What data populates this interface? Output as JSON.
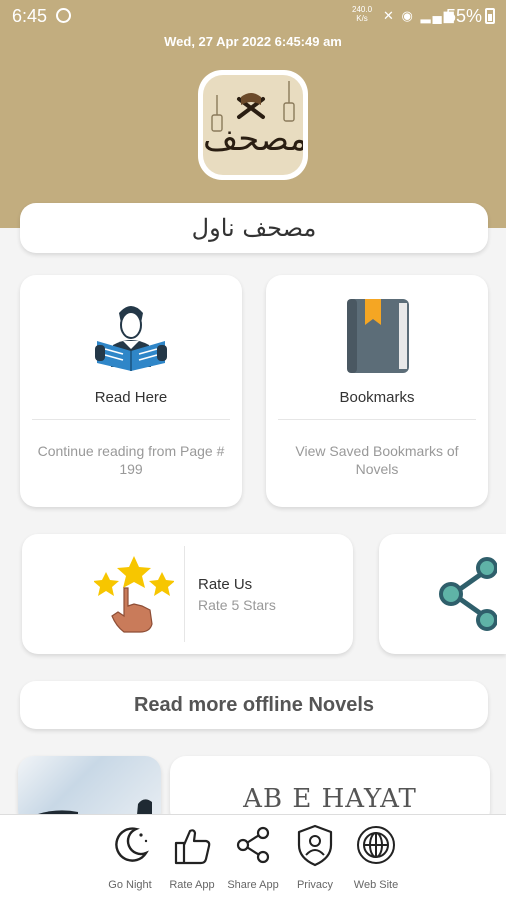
{
  "status_bar": {
    "time": "6:45",
    "speed_value": "240.0",
    "speed_unit": "K/s",
    "battery": "55%"
  },
  "date_time": "Wed, 27  Apr  2022   6:45:49 am",
  "logo": {
    "text": "مصحف"
  },
  "app_title": "مصحف ناول",
  "cards": {
    "read": {
      "title": "Read Here",
      "subtitle": "Continue reading from Page # 199",
      "icon": "reader-icon"
    },
    "bookmarks": {
      "title": "Bookmarks",
      "subtitle": "View Saved Bookmarks of Novels",
      "icon": "book-bookmark-icon"
    }
  },
  "rate": {
    "title": "Rate Us",
    "subtitle": "Rate 5 Stars",
    "icon": "rate-stars-icon"
  },
  "share": {
    "icon": "share-icon"
  },
  "more_novels": "Read more offline Novels",
  "novel": {
    "title": "AB E HAYAT"
  },
  "bottom_nav": [
    {
      "label": "Go Night",
      "icon": "moon-icon"
    },
    {
      "label": "Rate App",
      "icon": "thumbs-up-icon"
    },
    {
      "label": "Share App",
      "icon": "share-icon"
    },
    {
      "label": "Privacy",
      "icon": "shield-user-icon"
    },
    {
      "label": "Web Site",
      "icon": "globe-icon"
    }
  ],
  "colors": {
    "header": "#c2ad7f",
    "book": "#5c6d78",
    "bookmark": "#f5a623",
    "star": "#f7c600",
    "share": "#2f5f6b"
  }
}
